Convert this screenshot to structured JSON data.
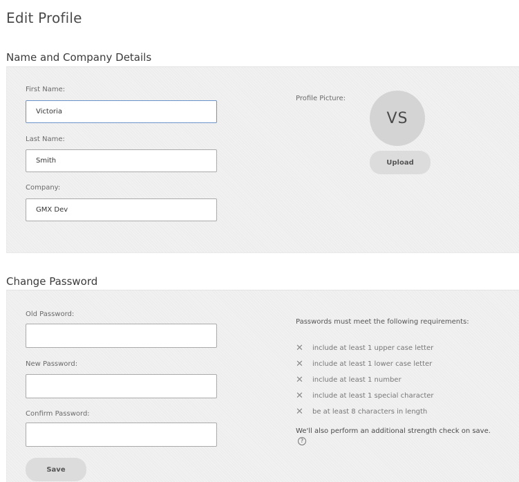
{
  "page": {
    "title": "Edit Profile"
  },
  "profile_section": {
    "title": "Name and Company Details",
    "first_name": {
      "label": "First Name:",
      "value": "Victoria"
    },
    "last_name": {
      "label": "Last Name:",
      "value": "Smith"
    },
    "company": {
      "label": "Company:",
      "value": "GMX Dev"
    },
    "picture": {
      "label": "Profile Picture:",
      "initials": "VS",
      "upload_label": "Upload"
    }
  },
  "password_section": {
    "title": "Change Password",
    "old_password": {
      "label": "Old Password:",
      "value": ""
    },
    "new_password": {
      "label": "New Password:",
      "value": ""
    },
    "confirm_password": {
      "label": "Confirm Password:",
      "value": ""
    },
    "save_label": "Save",
    "requirements_heading": "Passwords must meet the following requirements:",
    "requirements": [
      "include at least 1 upper case letter",
      "include at least 1 lower case letter",
      "include at least 1 number",
      "include at least 1 special character",
      "be at least 8 characters in length"
    ],
    "requirement_status_icon": "x-icon",
    "note": "We'll also perform an additional strength check on save.",
    "help_icon": "?"
  },
  "colors": {
    "panel_bg": "#f1f1f1",
    "button_bg": "#dcdcdc",
    "avatar_bg": "#d4d4d4",
    "focus_border": "#6a92c8"
  }
}
